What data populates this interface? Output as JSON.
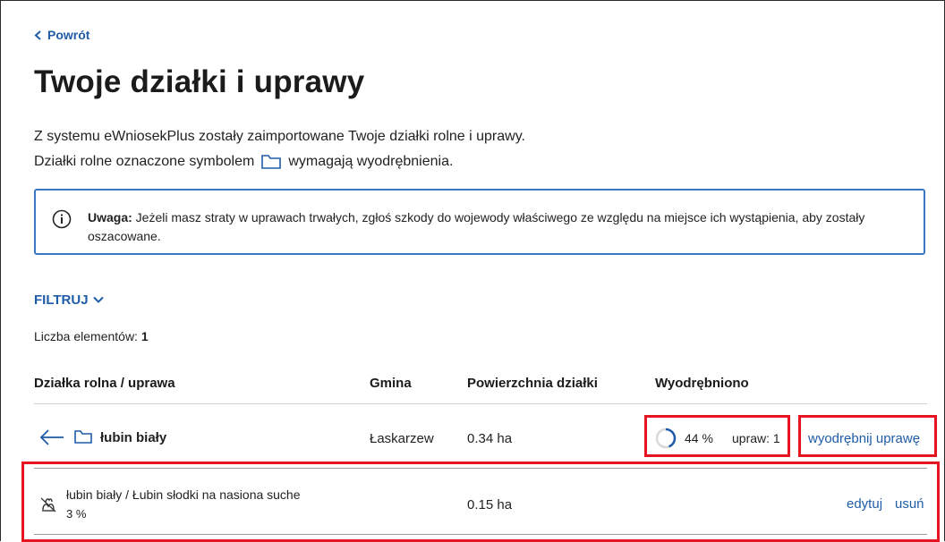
{
  "nav": {
    "back_label": "Powrót"
  },
  "page": {
    "title": "Twoje działki i uprawy",
    "intro_line1": "Z systemu eWniosekPlus zostały zaimportowane Twoje działki rolne i uprawy.",
    "intro_line2_before": "Działki rolne oznaczone symbolem",
    "intro_line2_after": "wymagają wyodrębnienia."
  },
  "alert": {
    "label": "Uwaga:",
    "text": " Jeżeli masz straty w uprawach trwałych, zgłoś szkody do wojewody właściwego ze względu na miejsce ich wystąpienia, aby zostały oszacowane."
  },
  "filter": {
    "label": "FILTRUJ"
  },
  "count": {
    "label": "Liczba elementów:",
    "value": "1"
  },
  "table": {
    "headers": {
      "parcel": "Działka rolna / uprawa",
      "gmina": "Gmina",
      "area": "Powierzchnia działki",
      "extracted": "Wyodrębniono"
    },
    "parcel_row": {
      "name": "łubin biały",
      "gmina": "Łaskarzew",
      "area": "0.34 ha",
      "progress_percent": 44,
      "progress_label": "44 %",
      "crops_label": "upraw: 1",
      "action": "wyodrębnij uprawę"
    },
    "crop_row": {
      "name": "łubin biały / Łubin słodki na nasiona suche",
      "share": "3 %",
      "area": "0.15 ha",
      "edit": "edytuj",
      "delete": "usuń"
    }
  },
  "colors": {
    "link": "#1f5ca8",
    "alert_border": "#3a78c3",
    "highlight": "#e5141e"
  },
  "icons": [
    "chevron-left-icon",
    "info-icon",
    "chevron-down-icon",
    "arrow-left-icon",
    "folder-icon",
    "progress-ring-icon",
    "crop-icon"
  ]
}
